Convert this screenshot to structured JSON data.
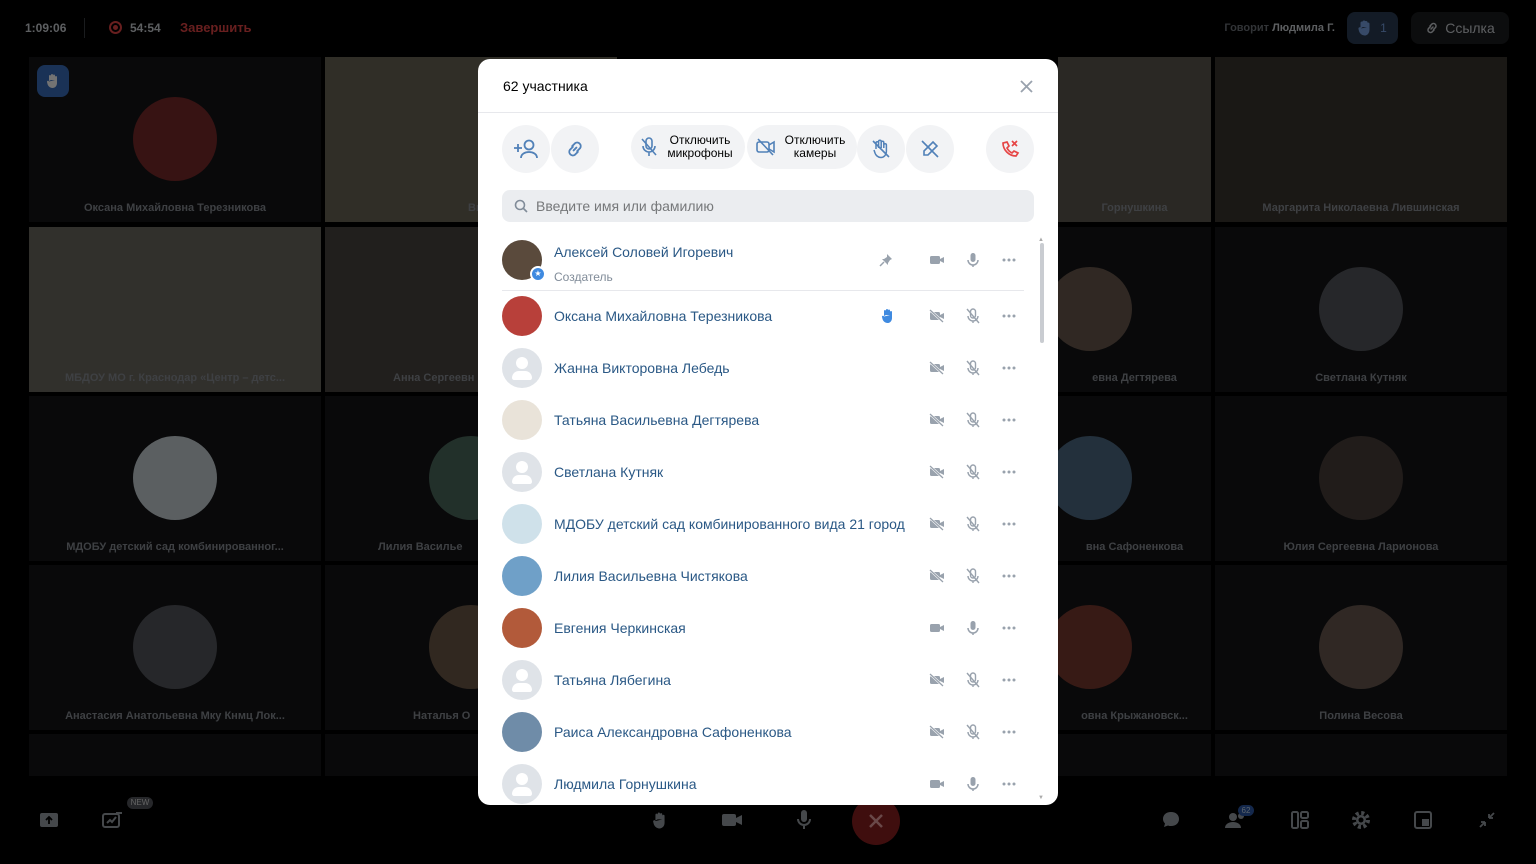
{
  "topbar": {
    "call_time": "1:09:06",
    "record_time": "54:54",
    "finish_label": "Завершить",
    "speaking_prefix": "Говорит",
    "speaking_name": "Людмила Г.",
    "raised_hands_count": "1",
    "link_label": "Ссылка"
  },
  "tiles": [
    {
      "name": "Оксана Михайловна Терезникова"
    },
    {
      "name": "Вь"
    },
    {
      "name": "Горнушкина"
    },
    {
      "name": "Маргарита Николаевна Лившинская"
    },
    {
      "name": "МБДОУ МО г. Краснодар «Центр – детс..."
    },
    {
      "name": "Анна Сергеевн"
    },
    {
      "name": "евна Дегтярева"
    },
    {
      "name": "Светлана Кутняк"
    },
    {
      "name": "МДОБУ детский сад комбинированног..."
    },
    {
      "name": "Лилия Василье"
    },
    {
      "name": "вна Сафоненкова"
    },
    {
      "name": "Юлия Сергеевна Ларионова"
    },
    {
      "name": "Анастасия Анатольевна Мку Кнмц Лок..."
    },
    {
      "name": "Наталья О"
    },
    {
      "name": "овна Крыжановск..."
    },
    {
      "name": "Полина Весова"
    }
  ],
  "bottombar": {
    "new_chip": "NEW",
    "participants_count": "62"
  },
  "modal": {
    "title": "62 участника",
    "tools": {
      "mute_mics_label": "Отключить микрофоны",
      "mute_cams_label": "Отключить камеры"
    },
    "search_placeholder": "Введите имя или фамилию",
    "participants": [
      {
        "name": "Алексей Соловей Игоревич",
        "role": "Создатель",
        "cam": "on",
        "mic": "on",
        "pinned": true,
        "hand": false
      },
      {
        "name": "Оксана Михайловна Терезникова",
        "cam": "off",
        "mic": "off",
        "hand": true
      },
      {
        "name": "Жанна Викторовна Лебедь",
        "cam": "off",
        "mic": "off"
      },
      {
        "name": "Татьяна Васильевна Дегтярева",
        "cam": "off",
        "mic": "off"
      },
      {
        "name": "Светлана Кутняк",
        "cam": "off",
        "mic": "off"
      },
      {
        "name": "МДОБУ детский сад комбинированного вида 21 город",
        "cam": "off",
        "mic": "off"
      },
      {
        "name": "Лилия Васильевна Чистякова",
        "cam": "off",
        "mic": "off"
      },
      {
        "name": "Евгения Черкинская",
        "cam": "on",
        "mic": "on"
      },
      {
        "name": "Татьяна Лябегина",
        "cam": "off",
        "mic": "off"
      },
      {
        "name": "Раиса Александровна Сафоненкова",
        "cam": "off",
        "mic": "off"
      },
      {
        "name": "Людмила Горнушкина",
        "cam": "on",
        "mic": "on"
      }
    ]
  },
  "colors": {
    "link": "#2a5885",
    "accent": "#3f8ae0",
    "danger": "#e64646"
  }
}
